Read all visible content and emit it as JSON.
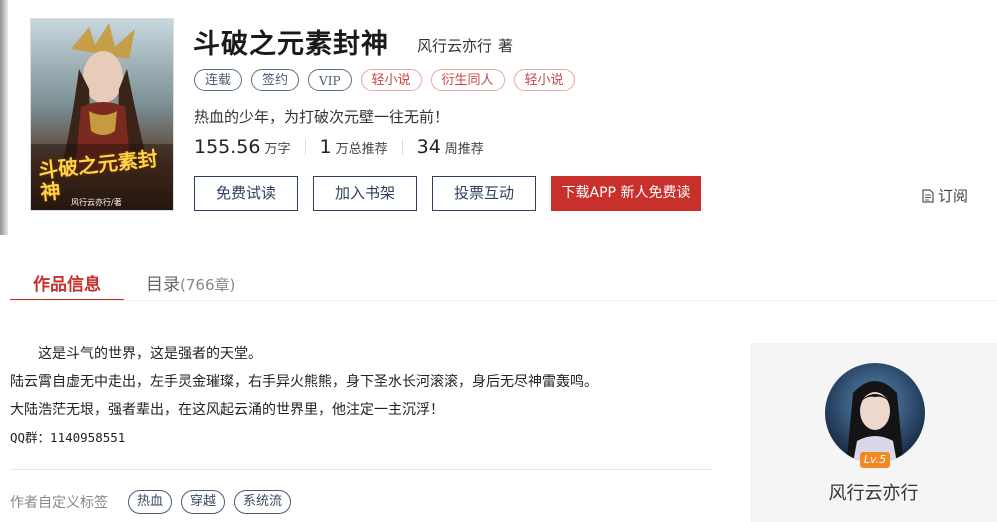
{
  "book": {
    "title": "斗破之元素封神",
    "author": "风行云亦行",
    "author_suffix": "著",
    "tags": [
      {
        "label": "连载",
        "style": "blue"
      },
      {
        "label": "签约",
        "style": "blue"
      },
      {
        "label": "VIP",
        "style": "blue"
      },
      {
        "label": "轻小说",
        "style": "red"
      },
      {
        "label": "衍生同人",
        "style": "red"
      },
      {
        "label": "轻小说",
        "style": "red"
      }
    ],
    "intro": "热血的少年，为打破次元壁一往无前！",
    "stats": [
      {
        "value": "155.56",
        "unit": "万字"
      },
      {
        "value": "1",
        "unit": "万总推荐"
      },
      {
        "value": "34",
        "unit": "周推荐"
      }
    ],
    "cover_text": "斗破之元素封神",
    "cover_sub": "风行云亦行/著"
  },
  "actions": {
    "free_read": "免费试读",
    "add_shelf": "加入书架",
    "vote": "投票互动",
    "download": "下载APP 新人免费读",
    "subscribe": "订阅"
  },
  "tabs": {
    "info": "作品信息",
    "catalog": "目录",
    "catalog_count": "(766章)"
  },
  "description": {
    "lines": [
      "这是斗气的世界，这是强者的天堂。",
      "陆云霄自虚无中走出，左手灵金璀璨，右手异火熊熊，身下圣水长河滚滚，身后无尽神雷轰鸣。",
      "大陆浩茫无垠，强者辈出，在这风起云涌的世界里，他注定一主沉浮！",
      "QQ群：1140958551"
    ]
  },
  "custom_tags": {
    "label": "作者自定义标签",
    "items": [
      "热血",
      "穿越",
      "系统流"
    ]
  },
  "author_card": {
    "name": "风行云亦行",
    "level": "Lv.5"
  },
  "colors": {
    "accent_red": "#c8302c",
    "navy": "#2f3f5e",
    "level_orange": "#f08a24"
  }
}
